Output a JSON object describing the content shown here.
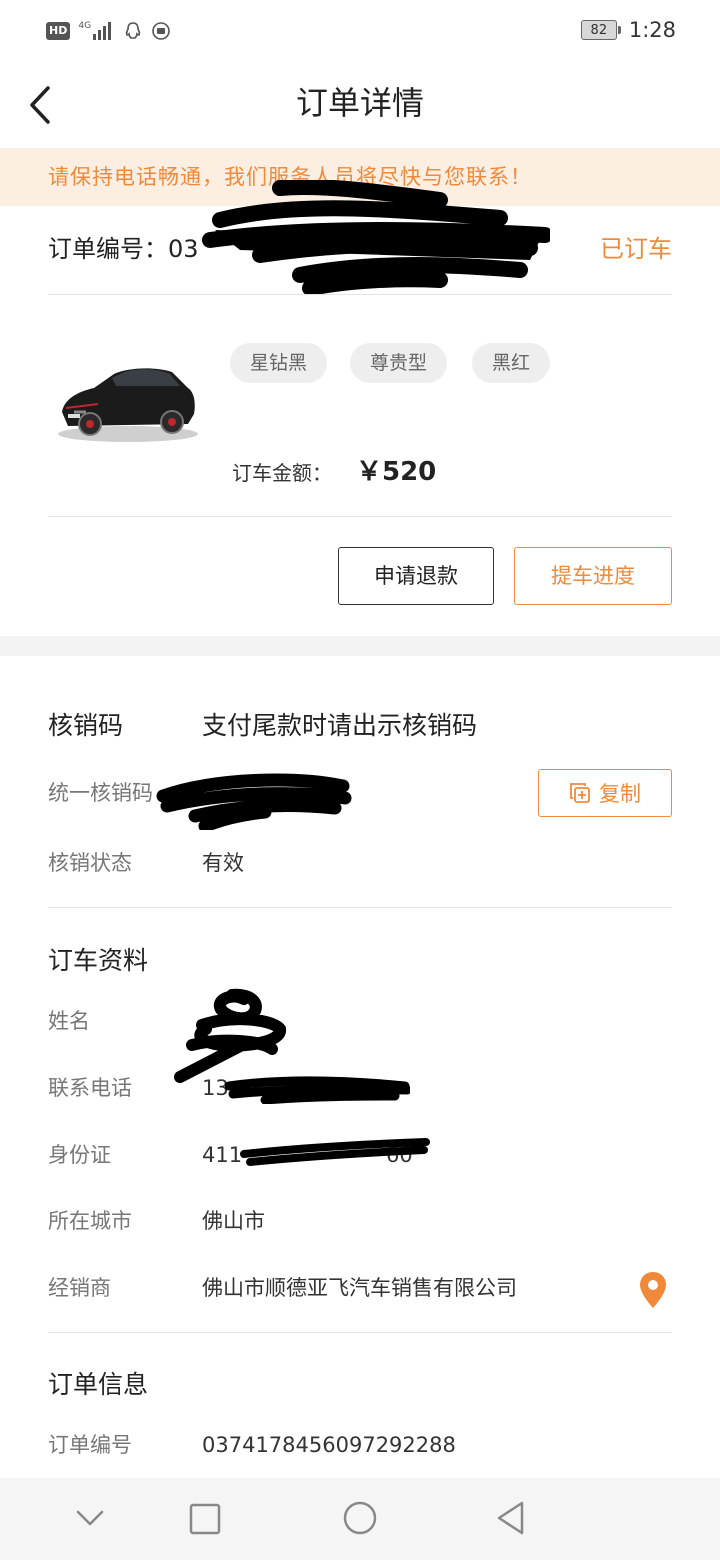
{
  "status_bar": {
    "hd": "HD",
    "network": "4G",
    "battery": "82",
    "time": "1:28"
  },
  "header": {
    "title": "订单详情"
  },
  "notice": "请保持电话畅通，我们服务人员将尽快与您联系！",
  "order": {
    "number_label": "订单编号：",
    "number_visible": "03",
    "status": "已订车"
  },
  "car": {
    "tags": [
      "星钻黑",
      "尊贵型",
      "黑红"
    ],
    "amount_label": "订车金额：",
    "amount_value": "￥520"
  },
  "actions": {
    "refund": "申请退款",
    "progress": "提车进度"
  },
  "verification": {
    "title": "核销码",
    "hint": "支付尾款时请出示核销码",
    "code_label": "统一核销码",
    "copy_label": "复制",
    "status_label": "核销状态",
    "status_value": "有效"
  },
  "booking": {
    "title": "订车资料",
    "name_label": "姓名",
    "phone_label": "联系电话",
    "phone_visible": "13",
    "id_label": "身份证",
    "id_visible": "411",
    "id_tail_visible": "60",
    "city_label": "所在城市",
    "city_value": "佛山市",
    "dealer_label": "经销商",
    "dealer_value": "佛山市顺德亚飞汽车销售有限公司"
  },
  "order_info": {
    "title": "订单信息",
    "number_label": "订单编号",
    "number_value": "0374178456097292288"
  },
  "colors": {
    "accent": "#f08a3a",
    "notice_bg": "#fdeee2"
  },
  "icons": {
    "back": "chevron-left-icon",
    "copy": "copy-icon",
    "location": "location-pin-icon",
    "nav_down": "chevron-down-icon",
    "nav_home": "square-icon",
    "nav_circle": "circle-icon",
    "nav_back": "triangle-back-icon"
  }
}
